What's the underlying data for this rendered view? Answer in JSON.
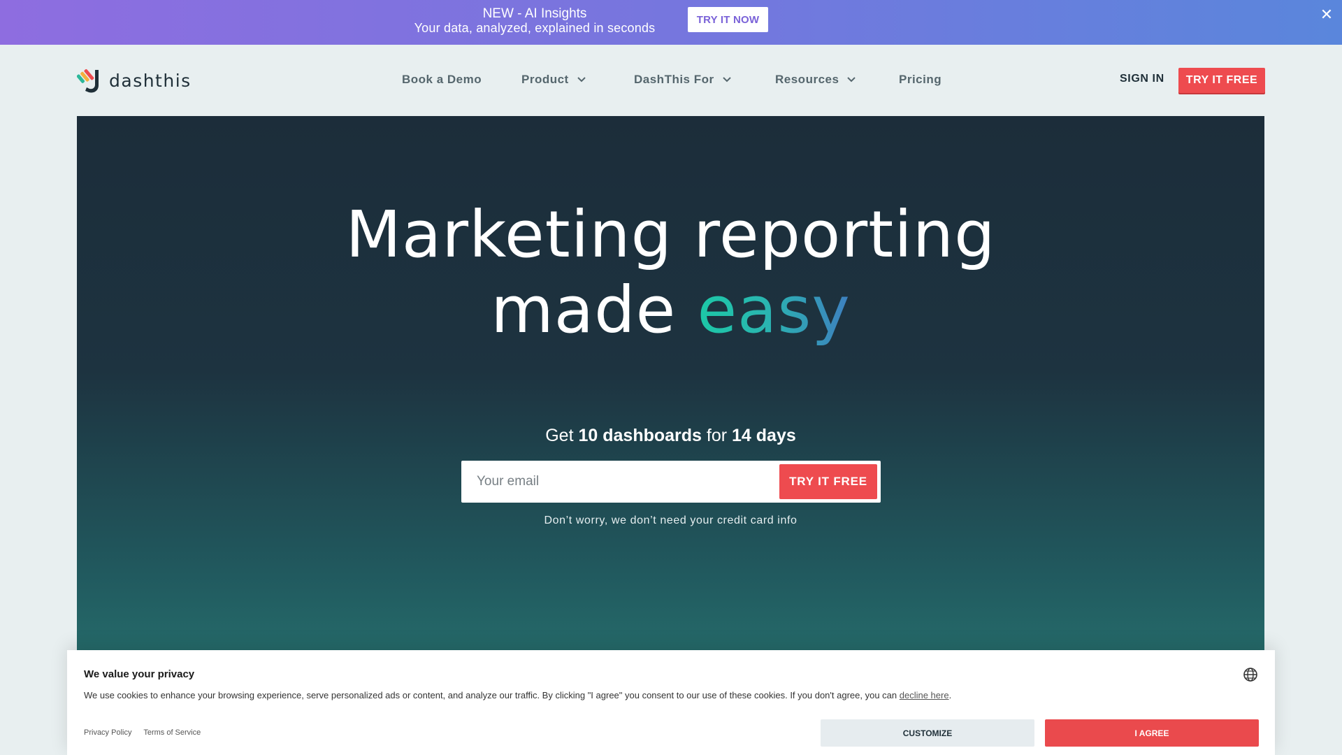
{
  "banner": {
    "title": "NEW - AI Insights",
    "subtitle": "Your data, analyzed, explained in seconds",
    "cta": "TRY IT NOW",
    "close_icon": "close-icon"
  },
  "header": {
    "logo_text": "dashthis",
    "nav": [
      {
        "label": "Book a Demo",
        "dropdown": false
      },
      {
        "label": "Product",
        "dropdown": true
      },
      {
        "label": "DashThis For",
        "dropdown": true
      },
      {
        "label": "Resources",
        "dropdown": true
      },
      {
        "label": "Pricing",
        "dropdown": false
      }
    ],
    "sign_in": "SIGN IN",
    "try_free": "TRY IT FREE"
  },
  "hero": {
    "title_line1": "Marketing reporting",
    "title_line2_plain": "made ",
    "title_line2_accent": "easy",
    "offer": {
      "prefix": "Get ",
      "dashboards": "10 dashboards",
      "middle": " for ",
      "days": "14 days"
    },
    "email_placeholder": "Your email",
    "cta": "TRY IT FREE",
    "note": "Don’t worry, we don’t need your credit card info"
  },
  "cookie": {
    "title": "We value your privacy",
    "text": "We use cookies to enhance your browsing experience, serve personalized ads or content, and analyze our traffic. By clicking \"I agree\" you consent to our use of these cookies. If you don't agree, you can ",
    "decline_link": "decline here",
    "text_end": ".",
    "privacy_policy": "Privacy Policy",
    "terms": "Terms of Service",
    "customize": "CUSTOMIZE",
    "agree": "I AGREE"
  },
  "colors": {
    "accent_red": "#ee4b4f",
    "banner_start": "#8e6de0",
    "banner_end": "#5a86dc",
    "hero_top": "#1c2d3a",
    "hero_bottom": "#2a7f77"
  }
}
